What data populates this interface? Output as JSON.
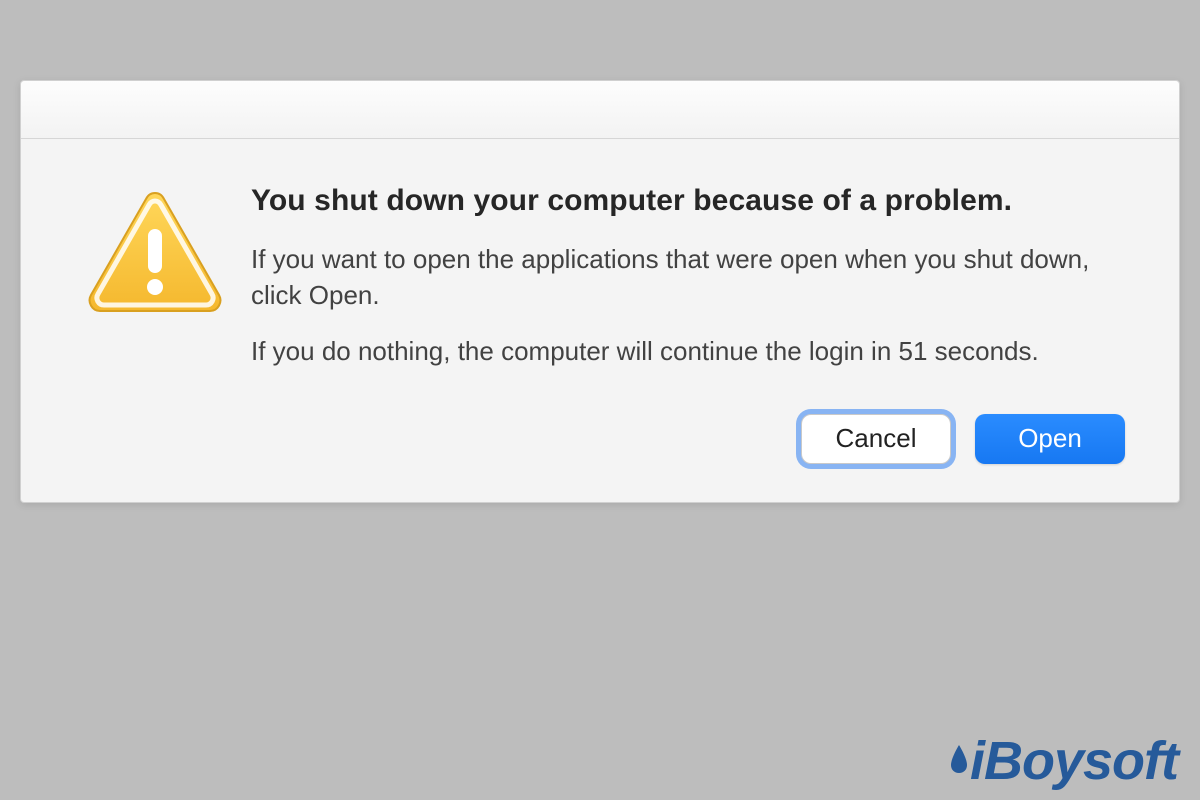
{
  "dialog": {
    "heading": "You shut down your computer because of a problem.",
    "paragraph1": "If you want to open the applications that were open when you shut down, click Open.",
    "paragraph2": "If you do nothing, the computer will continue the login in 51 seconds.",
    "buttons": {
      "cancel": "Cancel",
      "open": "Open"
    }
  },
  "watermark": {
    "text": "iBoysoft"
  }
}
